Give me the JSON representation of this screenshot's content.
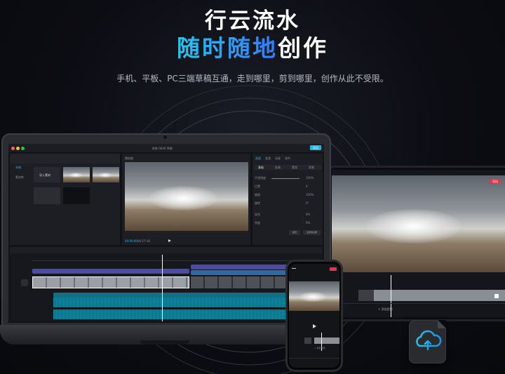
{
  "hero": {
    "title_line1": "行云流水",
    "title_line2_gradient": "随时随地",
    "title_line2_plain": "创作",
    "subtitle": "手机、平板、PC三端草稿互通，走到哪里，剪到哪里，创作从此不受限。"
  },
  "colors": {
    "accent_gradient_start": "#26c6f0",
    "accent_gradient_end": "#2f7cff",
    "export_button": "#e8334f",
    "background": "#0a0b10"
  },
  "devices": {
    "laptop": {
      "left_panel": {
        "import_label": "导入素材",
        "tab_local": "本地",
        "tab_library": "素材库"
      },
      "player_label": "播放器",
      "timecodes": {
        "current": "00:00:00",
        "total": "00:27:16"
      },
      "inspector": {
        "tabs": [
          "画面",
          "变速",
          "动画",
          "调节"
        ],
        "subtabs": [
          "基础",
          "抠像",
          "蒙版",
          "背景"
        ],
        "rows": [
          {
            "label": "不透明度",
            "value": "100%"
          },
          {
            "label": "位置",
            "value": "0"
          },
          {
            "label": "缩放",
            "value": "100%"
          },
          {
            "label": "旋转",
            "value": "0°"
          },
          {
            "label": "混合",
            "value": "0%"
          },
          {
            "label": "亮度",
            "value": "0%"
          }
        ],
        "buttons": [
          "重置",
          "应用到全部"
        ]
      },
      "export_label": "导出",
      "draft_title": "剪映 0830 草稿"
    },
    "tablet": {
      "export_label": "导出",
      "track_label": "+ 添加音频"
    },
    "phone": {
      "track_label": "+ 添加音频"
    },
    "cloud_icon": "cloud-sync-icon"
  }
}
